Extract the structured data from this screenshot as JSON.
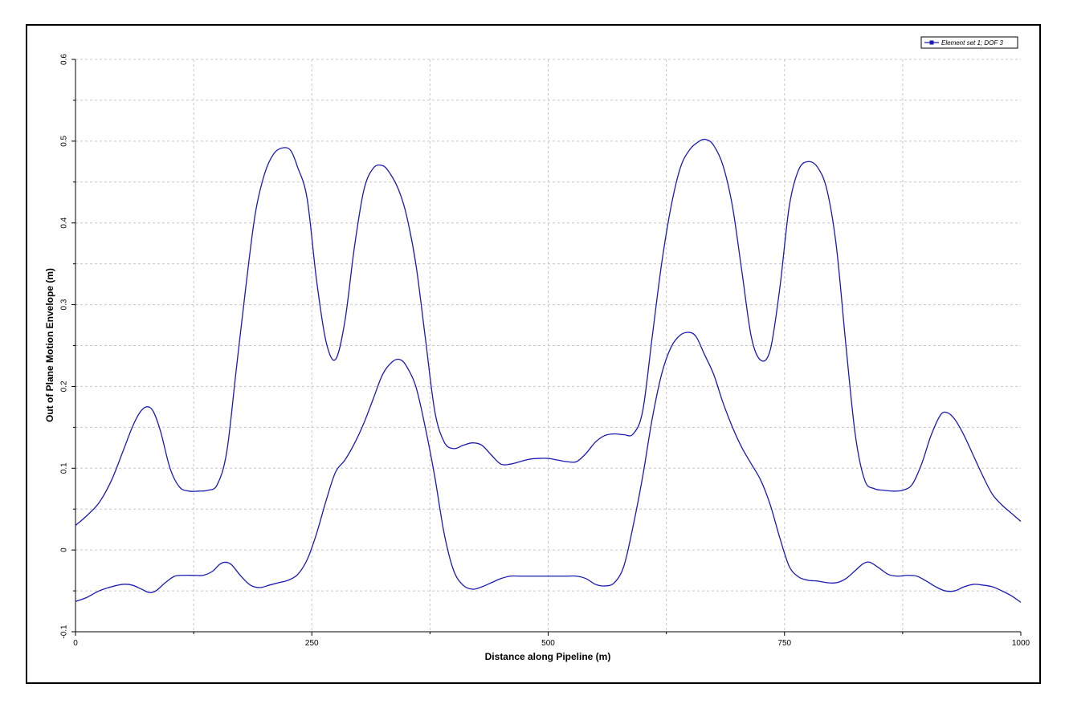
{
  "colors": {
    "series": "#1a1ab4",
    "grid": "#c8c8c8",
    "axis": "#000000"
  },
  "chart_data": {
    "type": "line",
    "title": "",
    "xlabel": "Distance along Pipeline (m)",
    "ylabel": "Out of Plane Motion Envelope (m)",
    "xlim": [
      0,
      1000
    ],
    "ylim": [
      -0.1,
      0.6
    ],
    "xticks": [
      0,
      250,
      500,
      750,
      1000
    ],
    "xtick_labels": [
      "0",
      "250",
      "500",
      "750",
      "1000"
    ],
    "yticks": [
      -0.1,
      0,
      0.1,
      0.2,
      0.3,
      0.4,
      0.5,
      0.6
    ],
    "ytick_labels": [
      "-0.1",
      "0",
      "0.1",
      "0.2",
      "0.3",
      "0.4",
      "0.5",
      "0.6"
    ],
    "grid": true,
    "legend": {
      "placement": "top-right",
      "entries": [
        "Element set  1; DOF  3"
      ]
    },
    "series": [
      {
        "name": "Element set  1; DOF  3",
        "role": "upper envelope",
        "x": [
          0,
          12,
          25,
          38,
          50,
          60,
          68,
          75,
          82,
          90,
          100,
          110,
          120,
          130,
          140,
          150,
          160,
          170,
          180,
          190,
          200,
          210,
          220,
          228,
          235,
          245,
          255,
          265,
          275,
          285,
          295,
          305,
          315,
          325,
          333,
          342,
          350,
          360,
          370,
          380,
          390,
          400,
          410,
          420,
          430,
          440,
          450,
          460,
          470,
          480,
          490,
          500,
          510,
          520,
          530,
          540,
          550,
          560,
          570,
          580,
          590,
          600,
          610,
          620,
          630,
          640,
          650,
          660,
          667,
          675,
          685,
          695,
          705,
          715,
          725,
          735,
          745,
          755,
          765,
          775,
          785,
          795,
          805,
          815,
          825,
          835,
          845,
          855,
          865,
          875,
          885,
          895,
          905,
          915,
          922,
          930,
          940,
          950,
          960,
          970,
          980,
          990,
          1000
        ],
        "values": [
          0.03,
          0.042,
          0.058,
          0.085,
          0.12,
          0.15,
          0.168,
          0.175,
          0.17,
          0.145,
          0.1,
          0.077,
          0.072,
          0.072,
          0.073,
          0.08,
          0.12,
          0.22,
          0.32,
          0.41,
          0.46,
          0.485,
          0.492,
          0.488,
          0.468,
          0.43,
          0.33,
          0.255,
          0.233,
          0.28,
          0.37,
          0.44,
          0.467,
          0.47,
          0.46,
          0.44,
          0.41,
          0.35,
          0.26,
          0.17,
          0.132,
          0.124,
          0.128,
          0.131,
          0.128,
          0.116,
          0.105,
          0.105,
          0.108,
          0.111,
          0.112,
          0.112,
          0.11,
          0.108,
          0.108,
          0.118,
          0.132,
          0.14,
          0.142,
          0.141,
          0.142,
          0.17,
          0.26,
          0.35,
          0.42,
          0.468,
          0.49,
          0.5,
          0.502,
          0.495,
          0.47,
          0.42,
          0.34,
          0.26,
          0.232,
          0.245,
          0.32,
          0.42,
          0.465,
          0.475,
          0.468,
          0.44,
          0.37,
          0.25,
          0.14,
          0.085,
          0.075,
          0.073,
          0.072,
          0.073,
          0.08,
          0.105,
          0.14,
          0.165,
          0.168,
          0.16,
          0.14,
          0.115,
          0.09,
          0.068,
          0.055,
          0.045,
          0.035
        ]
      },
      {
        "name": "",
        "role": "lower envelope",
        "x": [
          0,
          12,
          25,
          38,
          50,
          60,
          70,
          78,
          85,
          95,
          105,
          115,
          125,
          135,
          145,
          152,
          158,
          165,
          175,
          185,
          195,
          205,
          215,
          225,
          235,
          245,
          255,
          265,
          275,
          285,
          295,
          305,
          315,
          325,
          335,
          343,
          350,
          360,
          370,
          380,
          390,
          400,
          410,
          420,
          430,
          440,
          450,
          460,
          470,
          480,
          490,
          500,
          510,
          520,
          530,
          540,
          550,
          560,
          570,
          580,
          590,
          600,
          610,
          620,
          630,
          640,
          650,
          657,
          665,
          675,
          685,
          695,
          705,
          715,
          725,
          735,
          745,
          755,
          765,
          775,
          785,
          795,
          805,
          815,
          825,
          833,
          840,
          850,
          860,
          870,
          880,
          890,
          900,
          910,
          920,
          930,
          940,
          950,
          960,
          970,
          980,
          990,
          1000
        ],
        "values": [
          -0.063,
          -0.058,
          -0.05,
          -0.045,
          -0.042,
          -0.043,
          -0.048,
          -0.052,
          -0.05,
          -0.04,
          -0.032,
          -0.031,
          -0.031,
          -0.031,
          -0.026,
          -0.018,
          -0.015,
          -0.018,
          -0.032,
          -0.043,
          -0.046,
          -0.043,
          -0.04,
          -0.037,
          -0.03,
          -0.012,
          0.02,
          0.06,
          0.095,
          0.11,
          0.13,
          0.155,
          0.185,
          0.215,
          0.23,
          0.233,
          0.225,
          0.2,
          0.15,
          0.09,
          0.02,
          -0.025,
          -0.043,
          -0.048,
          -0.045,
          -0.04,
          -0.035,
          -0.032,
          -0.032,
          -0.032,
          -0.032,
          -0.032,
          -0.032,
          -0.032,
          -0.032,
          -0.035,
          -0.042,
          -0.044,
          -0.04,
          -0.02,
          0.03,
          0.09,
          0.16,
          0.215,
          0.248,
          0.263,
          0.266,
          0.26,
          0.24,
          0.215,
          0.18,
          0.15,
          0.125,
          0.105,
          0.085,
          0.055,
          0.015,
          -0.02,
          -0.033,
          -0.037,
          -0.038,
          -0.04,
          -0.04,
          -0.035,
          -0.025,
          -0.017,
          -0.015,
          -0.022,
          -0.03,
          -0.032,
          -0.031,
          -0.032,
          -0.038,
          -0.045,
          -0.05,
          -0.05,
          -0.045,
          -0.042,
          -0.043,
          -0.045,
          -0.05,
          -0.056,
          -0.064
        ]
      }
    ]
  }
}
